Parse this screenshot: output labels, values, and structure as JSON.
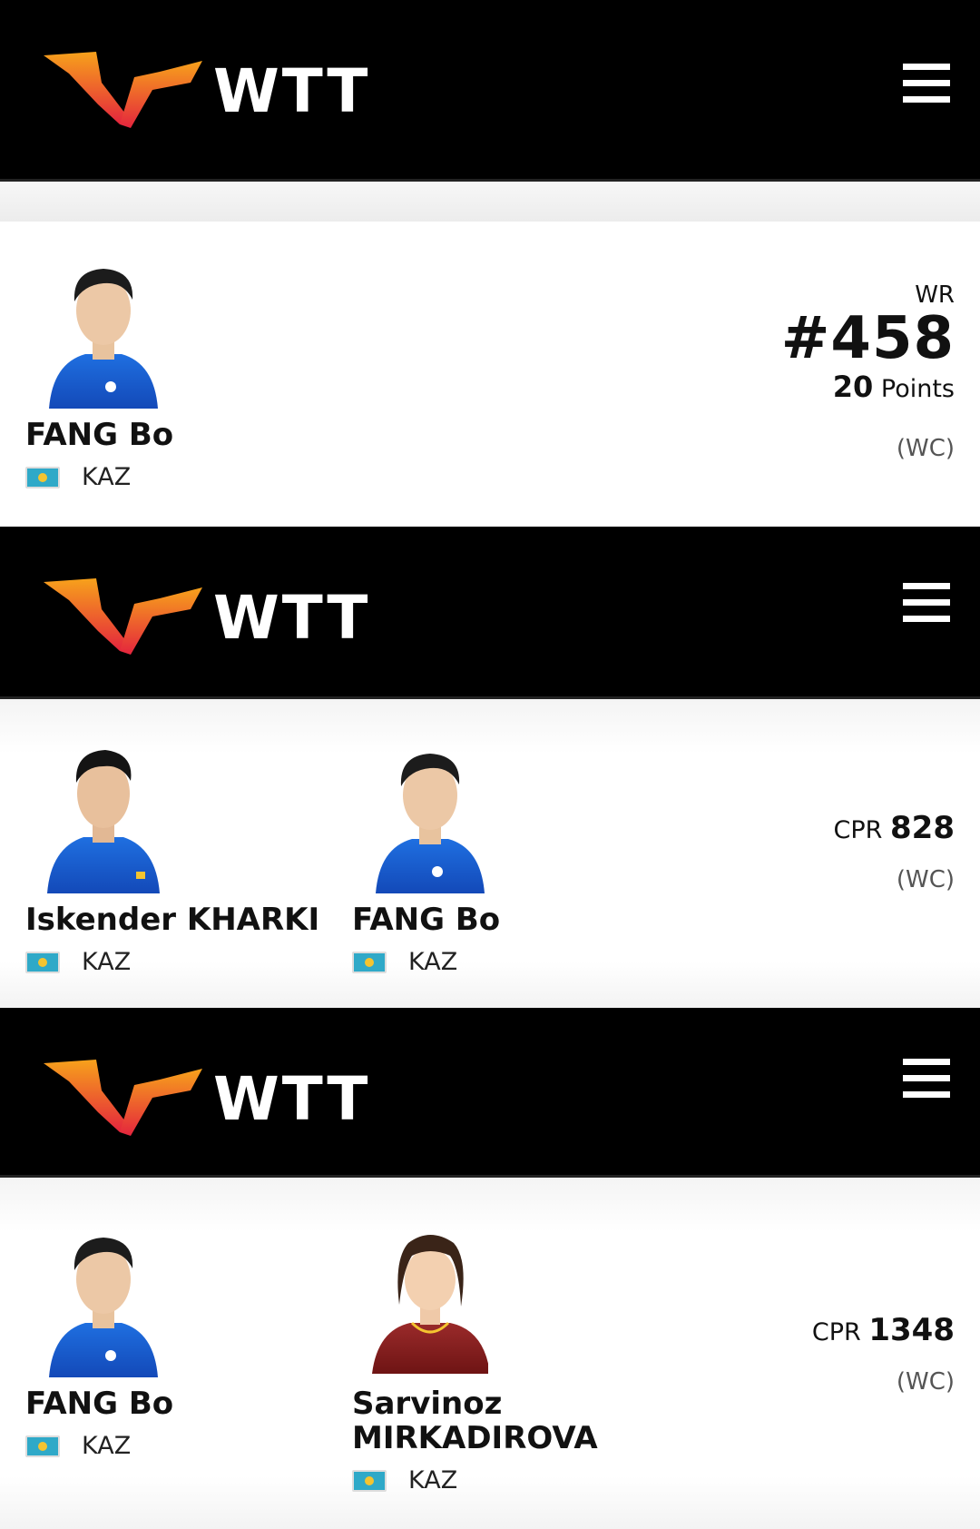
{
  "brand": "WTT",
  "colors": {
    "header_bg": "#000000",
    "logo_orange": "#f7a21b",
    "logo_red": "#e4253d",
    "flag_kaz": "#2fa9c8"
  },
  "icons": {
    "menu": "hamburger-menu-icon",
    "logo": "wtt-logo-icon",
    "flag": "kazakhstan-flag-icon"
  },
  "cards": [
    {
      "players": [
        {
          "name": "FANG Bo",
          "country": "KAZ"
        }
      ],
      "rank_label": "WR",
      "rank_value": "#458",
      "points_value": "20",
      "points_label": "Points",
      "tag": "(WC)"
    },
    {
      "players": [
        {
          "name": "Iskender KHARKI",
          "country": "KAZ"
        },
        {
          "name": "FANG Bo",
          "country": "KAZ"
        }
      ],
      "rank_label": "CPR",
      "rank_value": "828",
      "tag": "(WC)"
    },
    {
      "players": [
        {
          "name": "FANG Bo",
          "country": "KAZ"
        },
        {
          "name_line1": "Sarvinoz",
          "name_line2": "MIRKADIROVA",
          "country": "KAZ"
        }
      ],
      "rank_label": "CPR",
      "rank_value": "1348",
      "tag": "(WC)"
    }
  ]
}
